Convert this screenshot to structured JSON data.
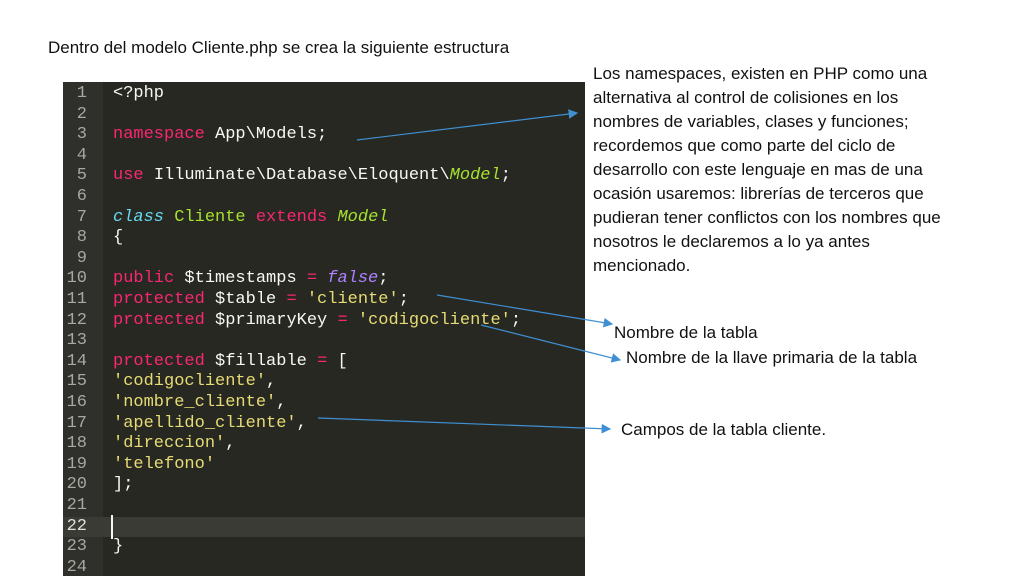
{
  "title": "Dentro del modelo Cliente.php se crea la siguiente estructura",
  "code_lines": [
    {
      "n": "1",
      "parts": [
        [
          "w",
          "<?php"
        ]
      ]
    },
    {
      "n": "2",
      "parts": []
    },
    {
      "n": "3",
      "parts": [
        [
          "k",
          "namespace "
        ],
        [
          "w",
          "App\\Models;"
        ]
      ]
    },
    {
      "n": "4",
      "parts": []
    },
    {
      "n": "5",
      "parts": [
        [
          "k",
          "use "
        ],
        [
          "w",
          "Illuminate\\Database\\Eloquent\\"
        ],
        [
          "gi",
          "Model"
        ],
        [
          "w",
          ";"
        ]
      ]
    },
    {
      "n": "6",
      "parts": []
    },
    {
      "n": "7",
      "parts": [
        [
          "c",
          "class "
        ],
        [
          "g",
          "Cliente "
        ],
        [
          "k",
          "extends "
        ],
        [
          "gi",
          "Model"
        ]
      ]
    },
    {
      "n": "8",
      "parts": [
        [
          "w",
          "{"
        ]
      ]
    },
    {
      "n": "9",
      "parts": []
    },
    {
      "n": "10",
      "parts": [
        [
          "k",
          "public "
        ],
        [
          "w",
          "$timestamps "
        ],
        [
          "k",
          "= "
        ],
        [
          "p",
          "false"
        ],
        [
          "w",
          ";"
        ]
      ]
    },
    {
      "n": "11",
      "parts": [
        [
          "k",
          "protected "
        ],
        [
          "w",
          "$table "
        ],
        [
          "k",
          "= "
        ],
        [
          "s",
          "'cliente'"
        ],
        [
          "w",
          ";"
        ]
      ]
    },
    {
      "n": "12",
      "parts": [
        [
          "k",
          "protected "
        ],
        [
          "w",
          "$primaryKey "
        ],
        [
          "k",
          "= "
        ],
        [
          "s",
          "'codigocliente'"
        ],
        [
          "w",
          ";"
        ]
      ]
    },
    {
      "n": "13",
      "parts": []
    },
    {
      "n": "14",
      "parts": [
        [
          "k",
          "protected "
        ],
        [
          "w",
          "$fillable "
        ],
        [
          "k",
          "= "
        ],
        [
          "w",
          "["
        ]
      ]
    },
    {
      "n": "15",
      "parts": [
        [
          "s",
          "'codigocliente'"
        ],
        [
          "w",
          ","
        ]
      ]
    },
    {
      "n": "16",
      "parts": [
        [
          "s",
          "'nombre_cliente'"
        ],
        [
          "w",
          ","
        ]
      ]
    },
    {
      "n": "17",
      "parts": [
        [
          "s",
          "'apellido_cliente'"
        ],
        [
          "w",
          ","
        ]
      ]
    },
    {
      "n": "18",
      "parts": [
        [
          "s",
          "'direccion'"
        ],
        [
          "w",
          ","
        ]
      ]
    },
    {
      "n": "19",
      "parts": [
        [
          "s",
          "'telefono'"
        ]
      ]
    },
    {
      "n": "20",
      "parts": [
        [
          "w",
          "];"
        ]
      ]
    },
    {
      "n": "21",
      "parts": []
    },
    {
      "n": "22",
      "parts": []
    },
    {
      "n": "23",
      "parts": [
        [
          "w",
          "}"
        ]
      ]
    },
    {
      "n": "24",
      "parts": []
    }
  ],
  "namespace_note": [
    "Los namespaces, existen en PHP como una",
    "alternativa al control de colisiones en los",
    "nombres de variables, clases y   funciones;",
    "recordemos que como parte del ciclo de",
    "desarrollo con este lenguaje en mas de una",
    "ocasión usaremos: librerías de terceros que",
    "pudieran tener conflictos con los nombres que",
    "nosotros le declaremos a lo ya antes",
    "mencionado."
  ],
  "table_note": "Nombre de la tabla",
  "primary_key_note": "Nombre de la llave primaria de la tabla",
  "fields_note": "Campos de la tabla cliente.",
  "colors": {
    "arrow": "#3f8fd2",
    "editor_bg": "#272822"
  }
}
